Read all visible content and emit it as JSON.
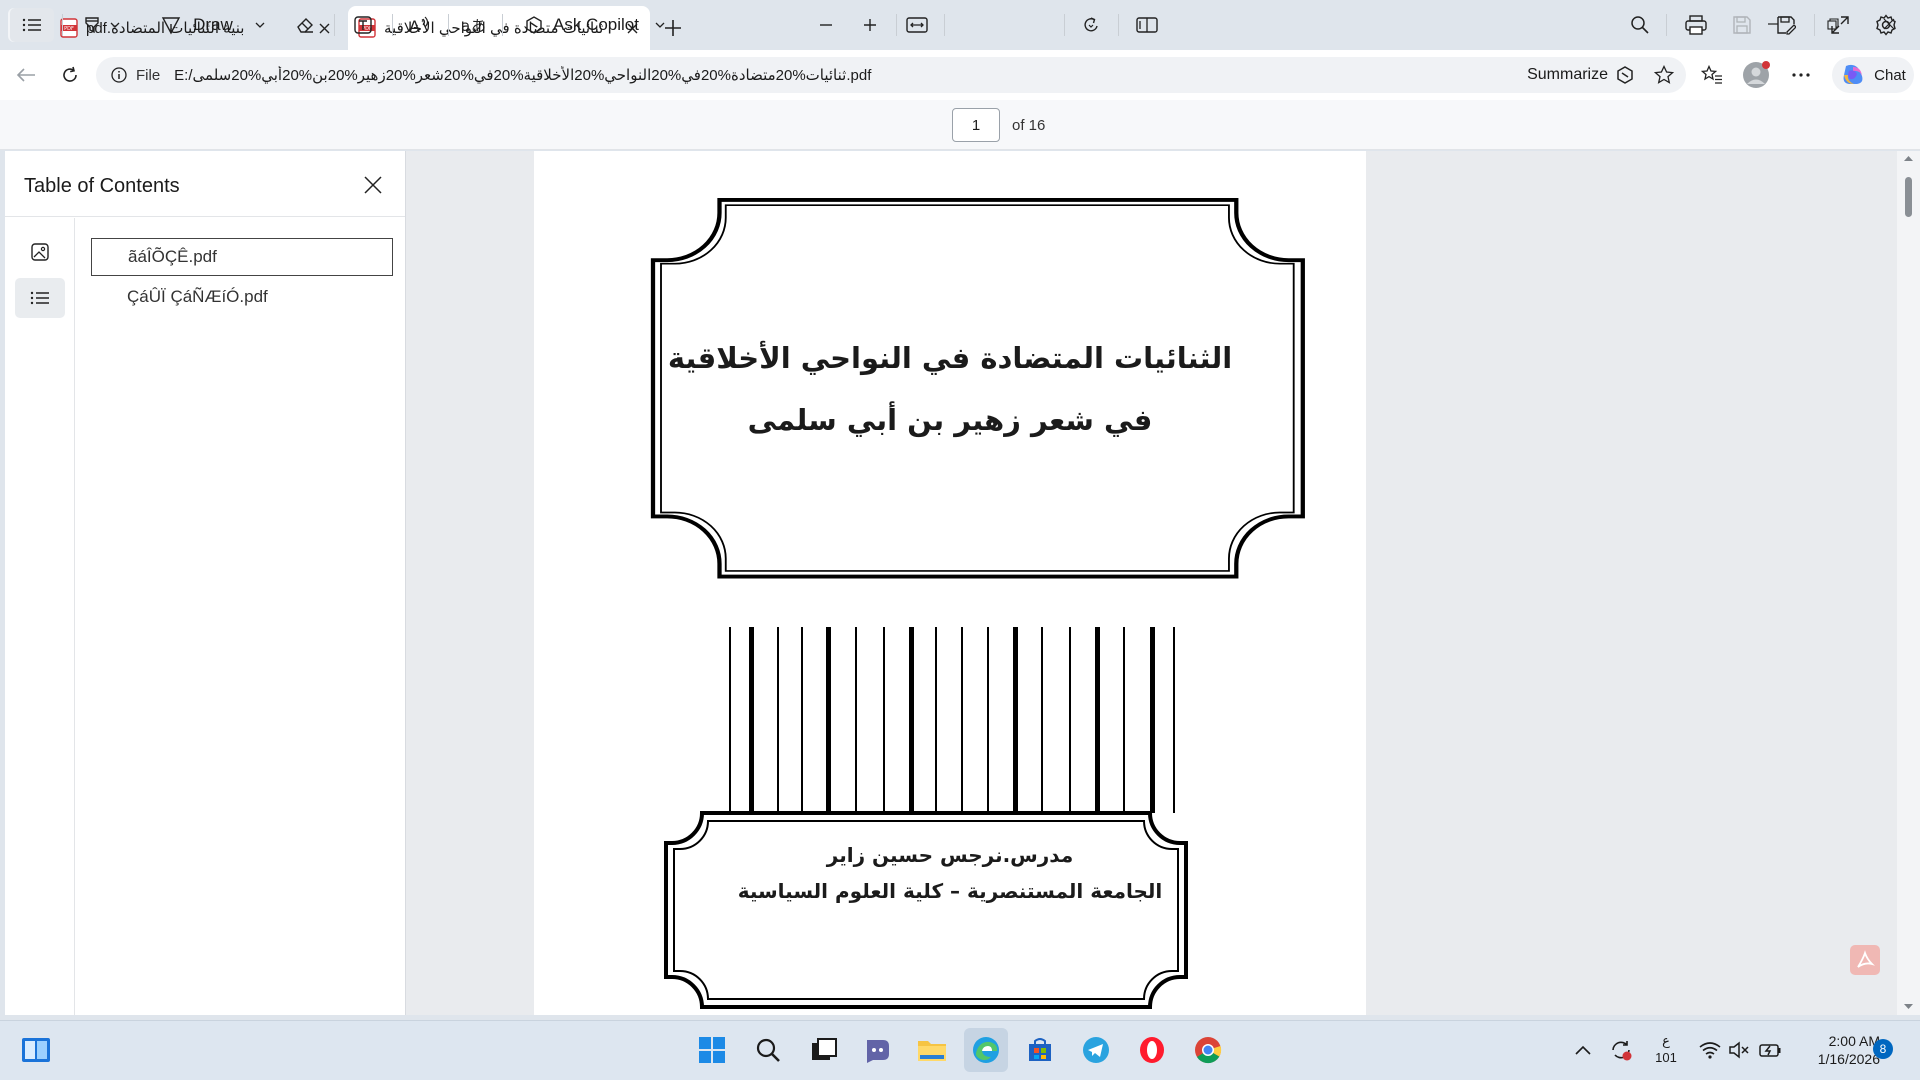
{
  "browser": {
    "tabs": [
      {
        "title": "بنية الثنائيات المتضادة.pdf",
        "icon": "pdf-icon",
        "active": false
      },
      {
        "title": "ثنائيات متضادة في النواحي الأخلاقية",
        "icon": "pdf-icon",
        "active": true
      }
    ],
    "address": {
      "scheme": "File",
      "url": "E:/ثنائيات%20متضادة%20في%20النواحي%20الأخلاقية%20في%20شعر%20زهير%20بن%20أبي%20سلمى.pdf",
      "summarize_label": "Summarize"
    },
    "chat_label": "Chat"
  },
  "pdf_toolbar": {
    "draw_label": "Draw",
    "ask_copilot_label": "Ask Copilot",
    "page_number": "1",
    "page_total": "of 16"
  },
  "sidebar": {
    "title": "Table of Contents",
    "items": [
      {
        "label": "ãáÎÕÇÊ.pdf",
        "selected": true
      },
      {
        "label": "ÇáÛÏ ÇáÑÆíÓ.pdf",
        "selected": false
      }
    ]
  },
  "document": {
    "title_line1": "الثنائيات المتضادة في النواحي الأخلاقية",
    "title_line2": "في شعر زهير بن أبي سلمى",
    "author_line": "مدرس.نرجس حسين زاير",
    "affiliation_line": "الجامعة المستنصرية – كلية العلوم السياسية"
  },
  "taskbar": {
    "tray": {
      "lang_top": "ع",
      "lang_bottom": "101",
      "time": "2:00 AM",
      "date": "1/16/2026",
      "notification_count": "8"
    }
  },
  "colors": {
    "accent": "#0067c0",
    "pdf_red": "#d13438",
    "tab_strip": "#dfe5ec"
  }
}
